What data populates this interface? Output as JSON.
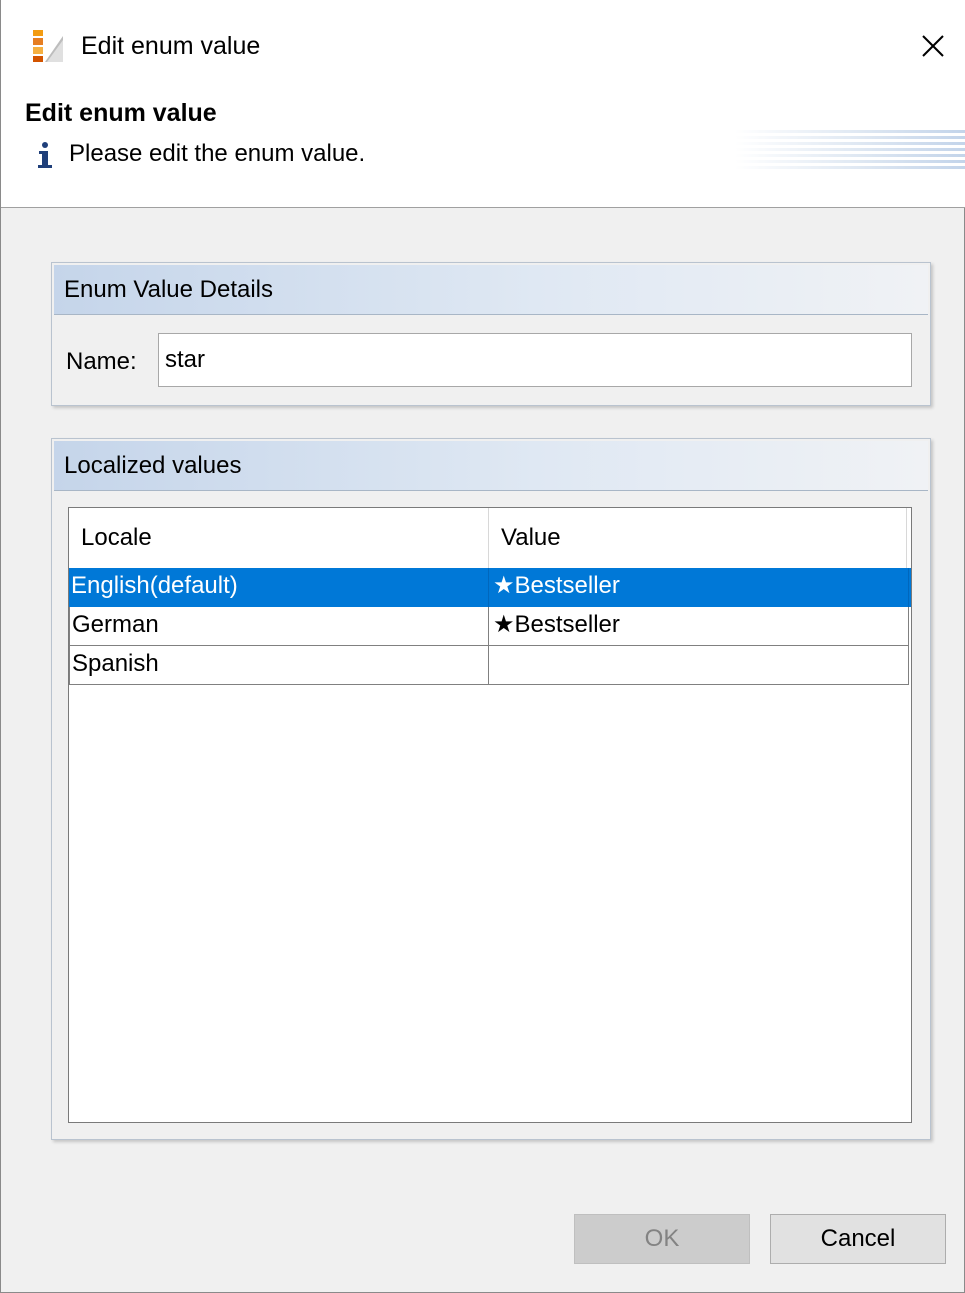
{
  "window": {
    "title": "Edit enum value",
    "close_icon": "close-icon"
  },
  "header": {
    "title": "Edit enum value",
    "info_icon": "info-icon",
    "message": "Please edit the enum value."
  },
  "details_group": {
    "title": "Enum Value Details",
    "name_label": "Name:",
    "name_value": "star"
  },
  "localized_group": {
    "title": "Localized values",
    "columns": [
      "Locale",
      "Value"
    ],
    "rows": [
      {
        "locale": "English(default)",
        "value": "★Bestseller",
        "selected": true
      },
      {
        "locale": "German",
        "value": "★Bestseller",
        "selected": false
      },
      {
        "locale": "Spanish",
        "value": "",
        "selected": false
      }
    ]
  },
  "buttons": {
    "ok_label": "OK",
    "ok_enabled": false,
    "cancel_label": "Cancel"
  },
  "colors": {
    "selection": "#0078d7",
    "group_header": "#c5d5ea",
    "dialog_background": "#f0f0f0"
  }
}
